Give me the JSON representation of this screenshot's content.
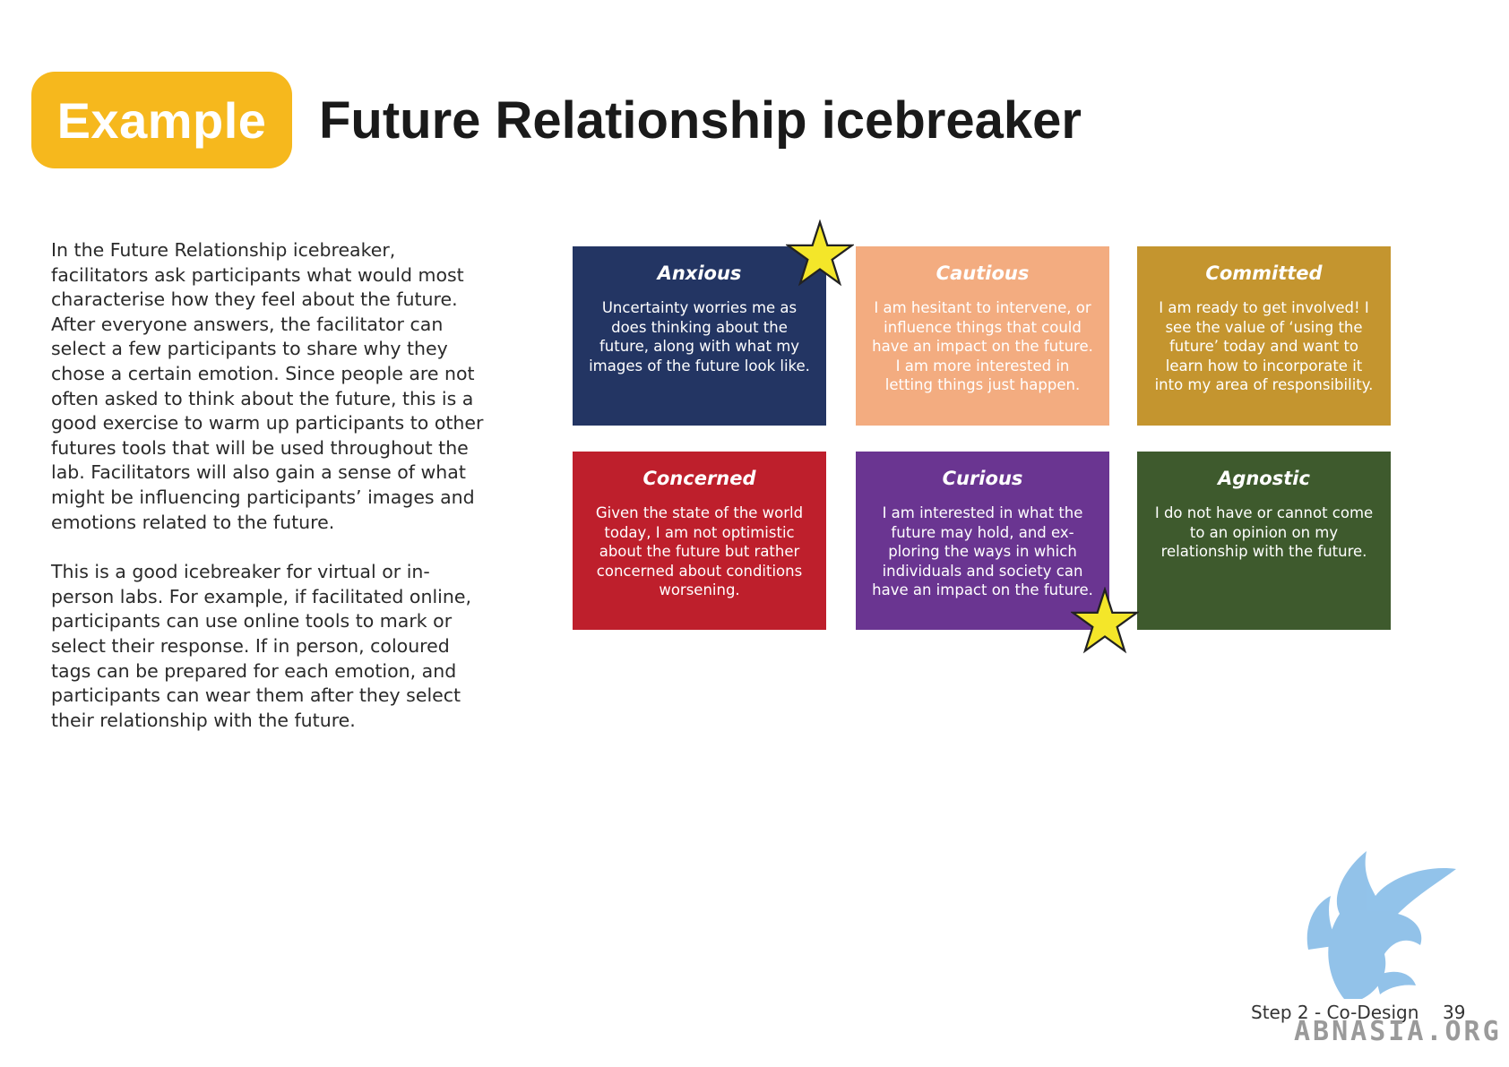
{
  "badge": {
    "label": "Example"
  },
  "title": "Future Relationship icebreaker",
  "body": {
    "paragraphs": [
      "In the Future Relationship icebreaker, facilitators ask participants what would most characterise how they feel about the future. After everyone answers, the facilitator can select a few participants to share why they chose a certain emotion. Since people are not often asked to think about the future, this is a good exercise to warm up participants to other futures tools that will be used throughout the lab. Facilitators will also gain a sense of what might be influencing participants’ images and emotions related to the future.",
      "This is a good icebreaker for virtual or in-person labs. For example, if facilitated online, participants can use online tools to mark or select their response. If in person, coloured tags can be prepared for each emotion, and participants can wear them after they select their relationship with the future."
    ]
  },
  "cards": [
    {
      "title": "Anxious",
      "text": "Uncertainty worries me as does thinking about the future, along with what my images of the future look like.",
      "color": "#233563"
    },
    {
      "title": "Cautious",
      "text": "I am hesitant to intervene, or influence things that could have an impact on the future. I am more interested in letting things just happen.",
      "color": "#f3ac80"
    },
    {
      "title": "Committed",
      "text": "I am ready to get involved! I see the value of ‘using the future’ today and want to learn how to incorporate it into my area of responsibility.",
      "color": "#c4952f"
    },
    {
      "title": "Concerned",
      "text": "Given the state of the world today, I am not optimistic about the future but rather concerned about conditions worsening.",
      "color": "#be1f2c"
    },
    {
      "title": "Curious",
      "text": "I am interested in what the future may hold, and ex-ploring the ways in which individuals and society can have an impact on the future.",
      "color": "#6a3591"
    },
    {
      "title": "Agnostic",
      "text": "I do not have or cannot come to an opinion on my relationship with the future.",
      "color": "#3e5a2d"
    }
  ],
  "star_color": "#f4e629",
  "footer": {
    "section": "Step 2 - Co-Design",
    "page_number": "39"
  },
  "watermark": {
    "text": "ABNASIA.ORG",
    "logo_icon": "griffin-logo-icon"
  }
}
